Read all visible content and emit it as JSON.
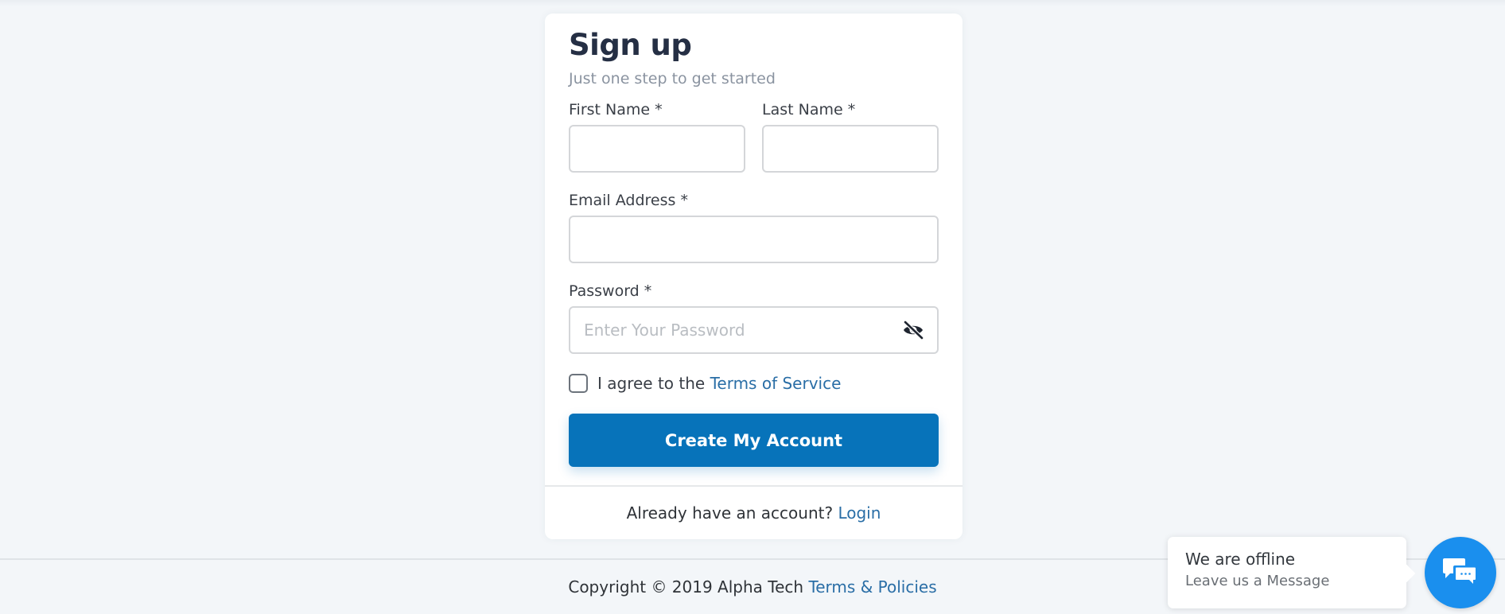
{
  "signup": {
    "title": "Sign up",
    "subtitle": "Just one step to get started",
    "first_name": {
      "label": "First Name *",
      "value": "",
      "placeholder": ""
    },
    "last_name": {
      "label": "Last Name *",
      "value": "",
      "placeholder": ""
    },
    "email": {
      "label": "Email Address *",
      "value": "",
      "placeholder": ""
    },
    "password": {
      "label": "Password *",
      "value": "",
      "placeholder": "Enter Your Password",
      "toggle_icon": "eye-slash-icon"
    },
    "agree": {
      "checked": false,
      "text": "I agree to the",
      "link_label": "Terms of Service"
    },
    "submit_label": "Create My Account",
    "footer": {
      "text": "Already have an account?",
      "link_label": "Login"
    }
  },
  "page_footer": {
    "text": "Copyright © 2019 Alpha Tech",
    "link_label": "Terms & Policies"
  },
  "chat_widget": {
    "title": "We are offline",
    "subtitle": "Leave us a Message",
    "icon": "chat-bubbles-icon"
  },
  "colors": {
    "primary": "#0773ba",
    "link": "#2a6ea6",
    "chat": "#1a8fee",
    "background": "#f3f6f9"
  }
}
